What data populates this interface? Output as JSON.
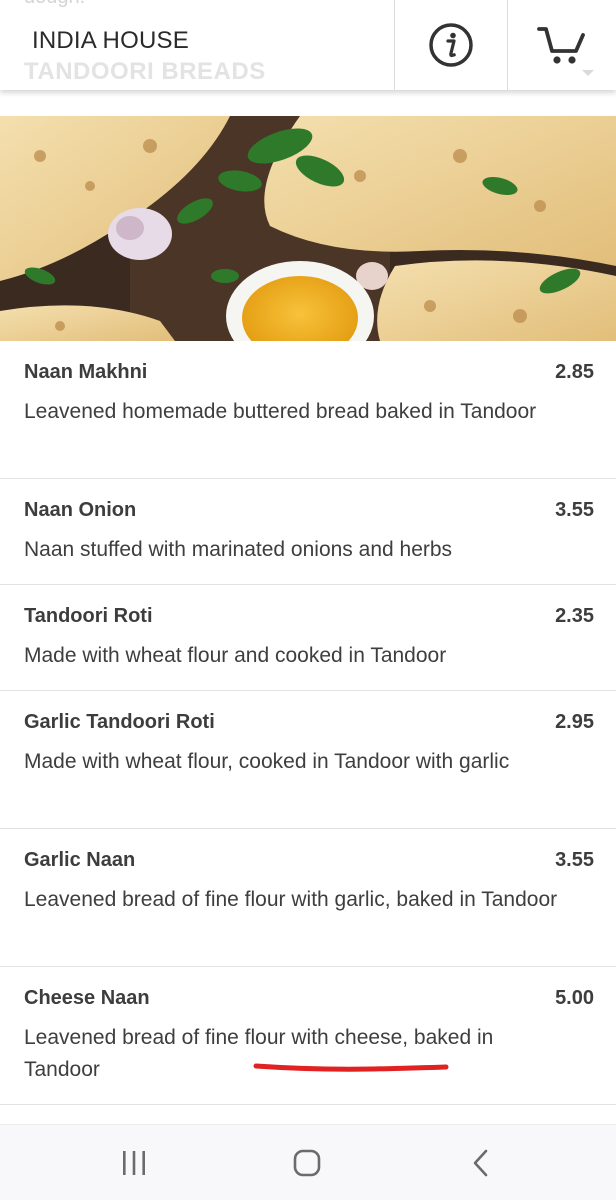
{
  "header": {
    "prev_text": "dough.",
    "restaurant_name": "INDIA HOUSE",
    "section_name": "TANDOORI BREADS",
    "info_icon": "info-circle-icon",
    "cart_icon": "cart-icon"
  },
  "hero": {
    "image": "garlic-naan-bread-photo"
  },
  "menu": {
    "items": [
      {
        "name": "Naan Makhni",
        "price": "2.85",
        "description": "Leavened homemade buttered bread baked in Tandoor"
      },
      {
        "name": "Naan Onion",
        "price": "3.55",
        "description": "Naan stuffed with marinated onions and herbs"
      },
      {
        "name": "Tandoori Roti",
        "price": "2.35",
        "description": "Made with wheat flour and cooked in Tandoor"
      },
      {
        "name": "Garlic Tandoori Roti",
        "price": "2.95",
        "description": "Made with wheat flour, cooked in Tandoor with garlic"
      },
      {
        "name": "Garlic Naan",
        "price": "3.55",
        "description": "Leavened bread of fine flour with garlic, baked in Tandoor"
      },
      {
        "name": "Cheese Naan",
        "price": "5.00",
        "description": "Leavened bread of fine flour with cheese, baked in Tandoor"
      }
    ]
  },
  "annotation": {
    "color": "#e02222"
  },
  "navbar": {
    "recents_icon": "recents-icon",
    "home_icon": "home-icon",
    "back_icon": "back-icon"
  }
}
